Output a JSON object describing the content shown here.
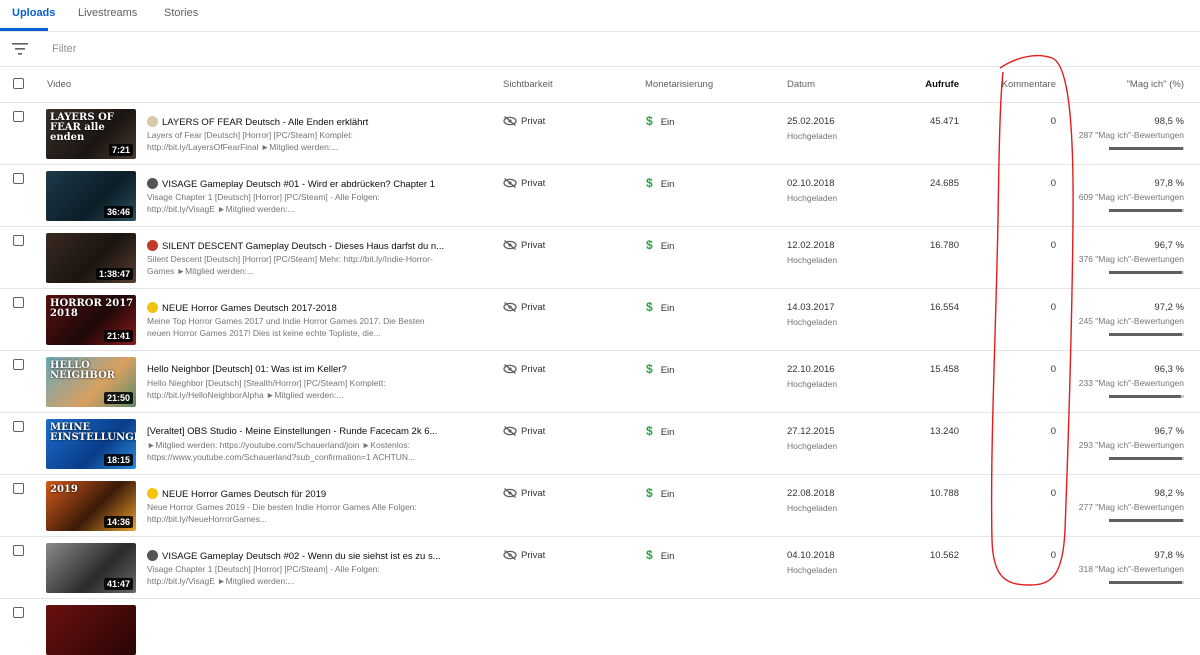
{
  "tabs": [
    {
      "label": "Uploads",
      "active": true
    },
    {
      "label": "Livestreams",
      "active": false
    },
    {
      "label": "Stories",
      "active": false
    }
  ],
  "filter": {
    "placeholder": "Filter",
    "icon": "filter-icon"
  },
  "columns": {
    "video": "Video",
    "visibility": "Sichtbarkeit",
    "monetization": "Monetarisierung",
    "date": "Datum",
    "views": "Aufrufe",
    "comments": "Kommentare",
    "likes": "\"Mag ich\" (%)"
  },
  "colors": {
    "accent": "#065fd4",
    "monetized": "#2ba640",
    "annotation": "#e31c1c"
  },
  "rows": [
    {
      "thumb_bg": "linear-gradient(135deg,#3a3028,#1b1512 60%,#4a3a2c)",
      "thumb_text": "LAYERS OF FEAR alle enden",
      "duration": "7:21",
      "emoji": "#d8c8a8",
      "title": "LAYERS OF FEAR Deutsch - Alle Enden erklährt",
      "description": "Layers of Fear [Deutsch] [Horror] [PC/Steam] Komplet: http://bit.ly/LayersOfFearFinal ►Mitglied werden:...",
      "visibility": "Privat",
      "monetization": "Ein",
      "date": "25.02.2016",
      "date_status": "Hochgeladen",
      "views": "45.471",
      "comments": "0",
      "likes": "98,5 %",
      "likes_count": "287 \"Mag ich\"-Bewertungen",
      "likes_ratio": 0.985
    },
    {
      "thumb_bg": "linear-gradient(135deg,#1d3a4a,#0c1d27 60%,#2a5060)",
      "thumb_text": "",
      "duration": "36:46",
      "emoji": "#555555",
      "title": "VISAGE Gameplay Deutsch #01 - Wird er abdrücken? Chapter 1",
      "description": "Visage Chapter 1 [Deutsch] [Horror] [PC/Steam] - Alle Folgen: http://bit.ly/VisagE ►Mitglied werden:...",
      "visibility": "Privat",
      "monetization": "Ein",
      "date": "02.10.2018",
      "date_status": "Hochgeladen",
      "views": "24.685",
      "comments": "0",
      "likes": "97,8 %",
      "likes_count": "609 \"Mag ich\"-Bewertungen",
      "likes_ratio": 0.978
    },
    {
      "thumb_bg": "linear-gradient(135deg,#3b2a22,#1a1410 55%,#5a3f30)",
      "thumb_text": "",
      "duration": "1:38:47",
      "emoji": "#c0392b",
      "title": "SILENT DESCENT Gameplay Deutsch - Dieses Haus darfst du n...",
      "description": "Silent Descent [Deutsch] [Horror] [PC/Steam] Mehr: http://bit.ly/Indie-Horror-Games ►Mitglied werden:...",
      "visibility": "Privat",
      "monetization": "Ein",
      "date": "12.02.2018",
      "date_status": "Hochgeladen",
      "views": "16.780",
      "comments": "0",
      "likes": "96,7 %",
      "likes_count": "376 \"Mag ich\"-Bewertungen",
      "likes_ratio": 0.967
    },
    {
      "thumb_bg": "linear-gradient(135deg,#5a1010,#1e0808 55%,#8a1a1a)",
      "thumb_text": "HORROR 2017 2018",
      "duration": "21:41",
      "emoji": "#f1c40f",
      "title": "NEUE Horror Games Deutsch 2017-2018",
      "description": "Meine Top Horror Games 2017 und Indie Horror Games 2017. Die Besten neuen Horror Games 2017! Dies ist keine echte Topliste, die...",
      "visibility": "Privat",
      "monetization": "Ein",
      "date": "14.03.2017",
      "date_status": "Hochgeladen",
      "views": "16.554",
      "comments": "0",
      "likes": "97,2 %",
      "likes_count": "245 \"Mag ich\"-Bewertungen",
      "likes_ratio": 0.972
    },
    {
      "thumb_bg": "linear-gradient(135deg,#6aa8b8,#d8a060 60%,#5b8a6a)",
      "thumb_text": "HELLO NEIGHBOR",
      "duration": "21:50",
      "emoji": "",
      "title": "Hello Neighbor [Deutsch] 01: Was ist im Keller?",
      "description": "Hello Nieghbor [Deutsch] [Stealth/Horror] [PC/Steam] Komplett: http://bit.ly/HelloNeighborAlpha ►Mitglied werden:...",
      "visibility": "Privat",
      "monetization": "Ein",
      "date": "22.10.2016",
      "date_status": "Hochgeladen",
      "views": "15.458",
      "comments": "0",
      "likes": "96,3 %",
      "likes_count": "233 \"Mag ich\"-Bewertungen",
      "likes_ratio": 0.963
    },
    {
      "thumb_bg": "linear-gradient(135deg,#1a6fd1,#0a3c88 60%,#2a90e0)",
      "thumb_text": "MEINE EINSTELLUNGEN",
      "duration": "18:15",
      "emoji": "",
      "title": "[Veraltet] OBS Studio - Meine Einstellungen - Runde Facecam 2k 6...",
      "description": "►Mitglied werden: https://youtube.com/Schauerland/join ►Kostenlos: https://www.youtube.com/Schauerland?sub_confirmation=1 ACHTUN...",
      "visibility": "Privat",
      "monetization": "Ein",
      "date": "27.12.2015",
      "date_status": "Hochgeladen",
      "views": "13.240",
      "comments": "0",
      "likes": "96,7 %",
      "likes_count": "293 \"Mag ich\"-Bewertungen",
      "likes_ratio": 0.967
    },
    {
      "thumb_bg": "linear-gradient(135deg,#d65a1a,#3a1a08 55%,#f0a030)",
      "thumb_text": "2019",
      "duration": "14:36",
      "emoji": "#f1c40f",
      "title": "NEUE Horror Games Deutsch für 2019",
      "description": "Neue Horror Games 2019 - Die besten Indie Horror Games Alle Folgen: http://bit.ly/NeueHorrorGames...",
      "visibility": "Privat",
      "monetization": "Ein",
      "date": "22.08.2018",
      "date_status": "Hochgeladen",
      "views": "10.788",
      "comments": "0",
      "likes": "98,2 %",
      "likes_count": "277 \"Mag ich\"-Bewertungen",
      "likes_ratio": 0.982
    },
    {
      "thumb_bg": "linear-gradient(135deg,#8a8a8a,#2a2a2a 60%,#6a6a6a)",
      "thumb_text": "",
      "duration": "41:47",
      "emoji": "#555555",
      "title": "VISAGE Gameplay Deutsch #02 - Wenn du sie siehst ist es zu s...",
      "description": "Visage Chapter 1 [Deutsch] [Horror] [PC/Steam] - Alle Folgen: http://bit.ly/VisagE ►Mitglied werden:...",
      "visibility": "Privat",
      "monetization": "Ein",
      "date": "04.10.2018",
      "date_status": "Hochgeladen",
      "views": "10.562",
      "comments": "0",
      "likes": "97,8 %",
      "likes_count": "318 \"Mag ich\"-Bewertungen",
      "likes_ratio": 0.978
    }
  ]
}
